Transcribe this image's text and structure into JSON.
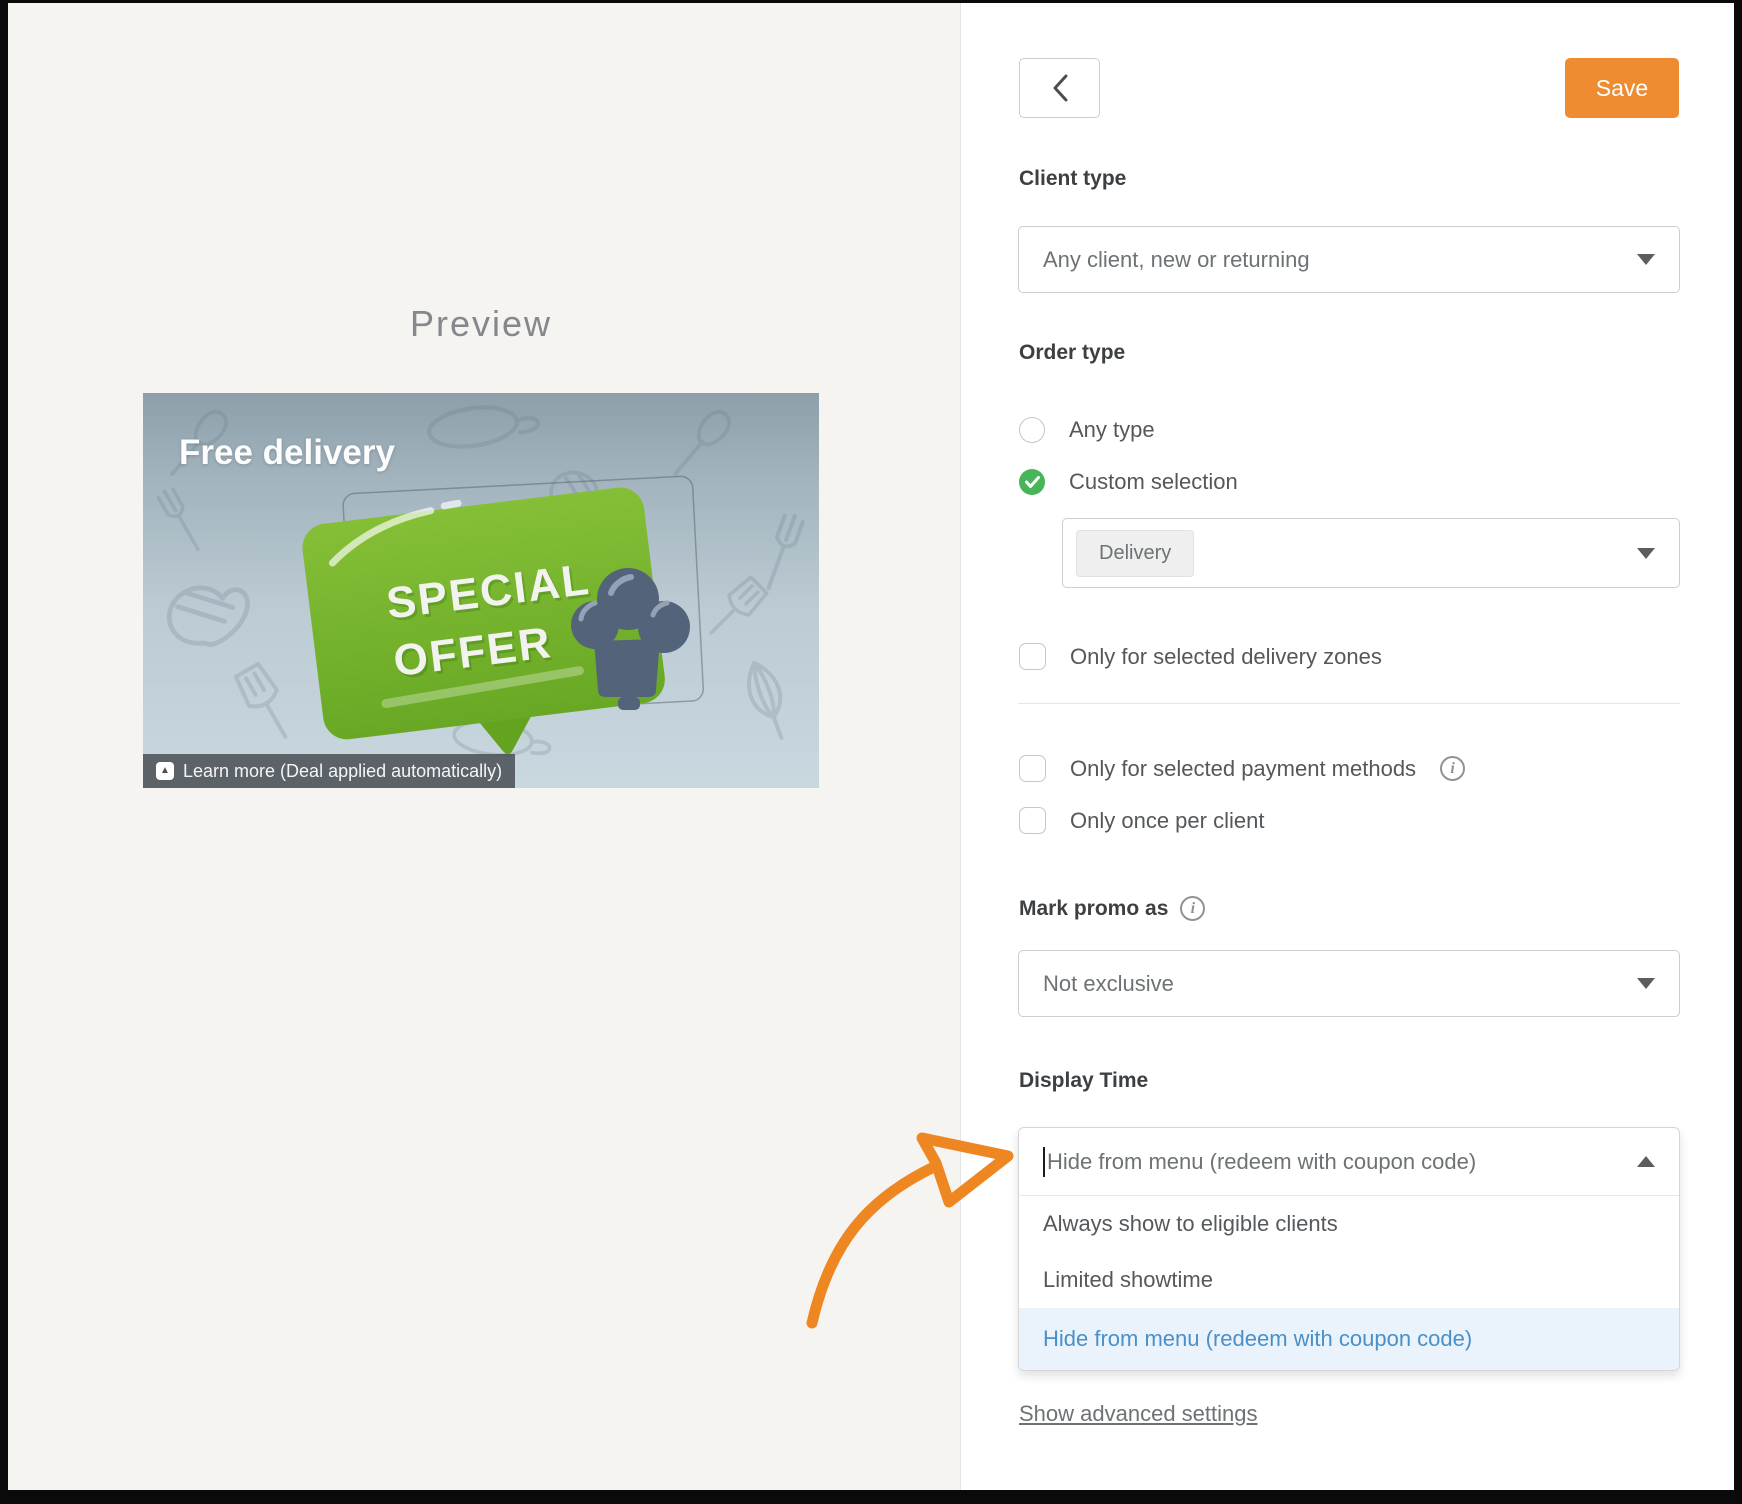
{
  "preview": {
    "title": "Preview",
    "banner": {
      "headline": "Free delivery",
      "bubble_line1": "SPECIAL",
      "bubble_line2": "OFFER",
      "caption": "Learn more (Deal applied automatically)"
    }
  },
  "toolbar": {
    "save_label": "Save"
  },
  "form": {
    "client_type": {
      "label": "Client type",
      "value": "Any client, new or returning"
    },
    "order_type": {
      "label": "Order type",
      "options": [
        {
          "label": "Any type",
          "selected": false
        },
        {
          "label": "Custom selection",
          "selected": true
        }
      ],
      "selection_tags": [
        "Delivery"
      ]
    },
    "checkboxes": [
      {
        "label": "Only for selected delivery zones",
        "checked": false,
        "has_info": false
      },
      {
        "label": "Only for selected payment methods",
        "checked": false,
        "has_info": true
      },
      {
        "label": "Only once per client",
        "checked": false,
        "has_info": false
      }
    ],
    "mark_promo_as": {
      "label": "Mark promo as",
      "value": "Not exclusive",
      "has_info": true
    },
    "display_time": {
      "label": "Display Time",
      "value": "Hide from menu (redeem with coupon code)",
      "options": [
        "Always show to eligible clients",
        "Limited showtime",
        "Hide from menu (redeem with coupon code)"
      ],
      "selected_index": 2
    },
    "advanced_link": "Show advanced settings"
  },
  "colors": {
    "accent_orange": "#ef8c31",
    "arrow_orange": "#ee8722",
    "radio_green": "#47b558",
    "option_blue": "#4a90c8",
    "option_blue_bg": "#eaf3fb",
    "bubble_green": "#76b82a",
    "banner_bg_top": "#8c9faa",
    "banner_bg_bottom": "#c9d8df",
    "chef_hat": "#53637a"
  }
}
